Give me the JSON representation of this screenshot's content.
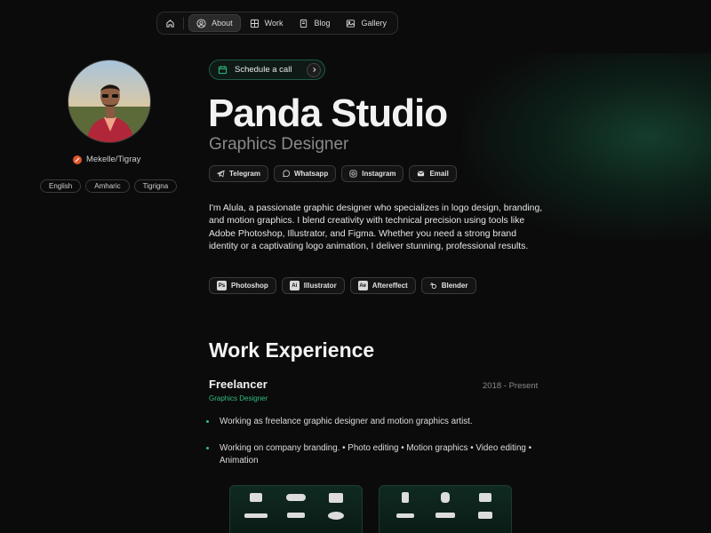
{
  "nav": {
    "items": [
      {
        "label": "About",
        "icon": "user-circle-icon",
        "active": true
      },
      {
        "label": "Work",
        "icon": "grid-icon",
        "active": false
      },
      {
        "label": "Blog",
        "icon": "book-icon",
        "active": false
      },
      {
        "label": "Gallery",
        "icon": "image-icon",
        "active": false
      }
    ]
  },
  "profile": {
    "location": "Mekelle/Tigray",
    "languages": [
      "English",
      "Amharic",
      "Tigrigna"
    ]
  },
  "header": {
    "schedule_label": "Schedule a call",
    "name": "Panda Studio",
    "role": "Graphics Designer"
  },
  "socials": [
    {
      "label": "Telegram",
      "icon": "telegram-icon"
    },
    {
      "label": "Whatsapp",
      "icon": "whatsapp-icon"
    },
    {
      "label": "Instagram",
      "icon": "instagram-icon"
    },
    {
      "label": "Email",
      "icon": "email-icon"
    }
  ],
  "bio": "I'm Alula, a passionate graphic designer who specializes in logo design, branding, and motion graphics. I blend creativity with technical precision using tools like Adobe Photoshop, Illustrator, and Figma. Whether you need a strong brand identity or a captivating logo animation, I deliver stunning, professional results.",
  "tools": [
    {
      "label": "Photoshop",
      "icon": "photoshop-icon",
      "abbr": "Ps"
    },
    {
      "label": "Illustrator",
      "icon": "illustrator-icon",
      "abbr": "Ai"
    },
    {
      "label": "Aftereffect",
      "icon": "aftereffects-icon",
      "abbr": "Ae"
    },
    {
      "label": "Blender",
      "icon": "blender-icon",
      "abbr": ""
    }
  ],
  "experience": {
    "section_title": "Work Experience",
    "job_title": "Freelancer",
    "job_role": "Graphics Designer",
    "job_dates": "2018 - Present",
    "bullets": [
      "Working as freelance graphic designer and motion graphics artist.",
      "Working on company branding. • Photo editing • Motion graphics • Video editing • Animation"
    ]
  },
  "colors": {
    "accent": "#2fbf7f",
    "background": "#0b0b0b",
    "location_dot": "#e0562a"
  }
}
